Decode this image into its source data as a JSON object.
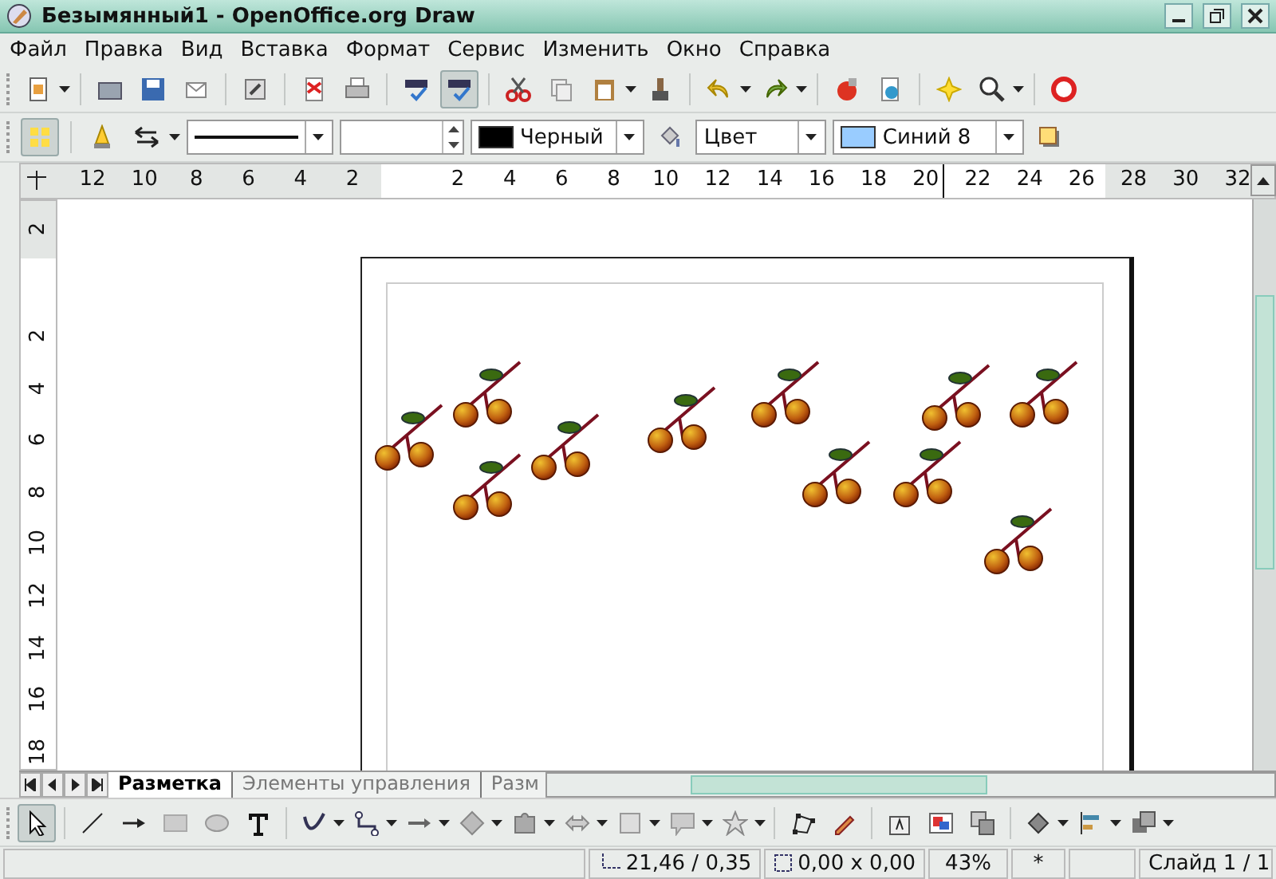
{
  "window": {
    "title": "Безымянный1 - OpenOffice.org Draw"
  },
  "menu": [
    "Файл",
    "Правка",
    "Вид",
    "Вставка",
    "Формат",
    "Сервис",
    "Изменить",
    "Окно",
    "Справка"
  ],
  "standard_toolbar": {
    "autospellcheck_selected": true
  },
  "line_fill_toolbar": {
    "points_selected": true,
    "line_color": {
      "value": "Черный",
      "color": "#000000"
    },
    "area_style": {
      "value": "Цвет"
    },
    "fill_color": {
      "value": "Синий 8",
      "color": "#99ccff"
    }
  },
  "horizontal_ruler": {
    "left_labels": [
      "12",
      "10",
      "8",
      "6",
      "4",
      "2"
    ],
    "right_labels": [
      "2",
      "4",
      "6",
      "8",
      "10",
      "12",
      "14",
      "16",
      "18",
      "20",
      "22",
      "24",
      "26",
      "28",
      "30",
      "32"
    ]
  },
  "vertical_ruler": {
    "top_label": "2",
    "labels": [
      "2",
      "4",
      "6",
      "8",
      "10",
      "12",
      "14",
      "16",
      "18"
    ]
  },
  "sheet_tabs": [
    {
      "label": "Разметка",
      "selected": true
    },
    {
      "label": "Элементы управления",
      "selected": false
    },
    {
      "label": "Разм",
      "selected": false
    }
  ],
  "drawing_toolbar": {
    "select_selected": true
  },
  "status_bar": {
    "position": "21,46 / 0,35",
    "size": "0,00 x 0,00",
    "zoom": "43%",
    "modified": "*",
    "slide": "Слайд 1 / 1"
  }
}
